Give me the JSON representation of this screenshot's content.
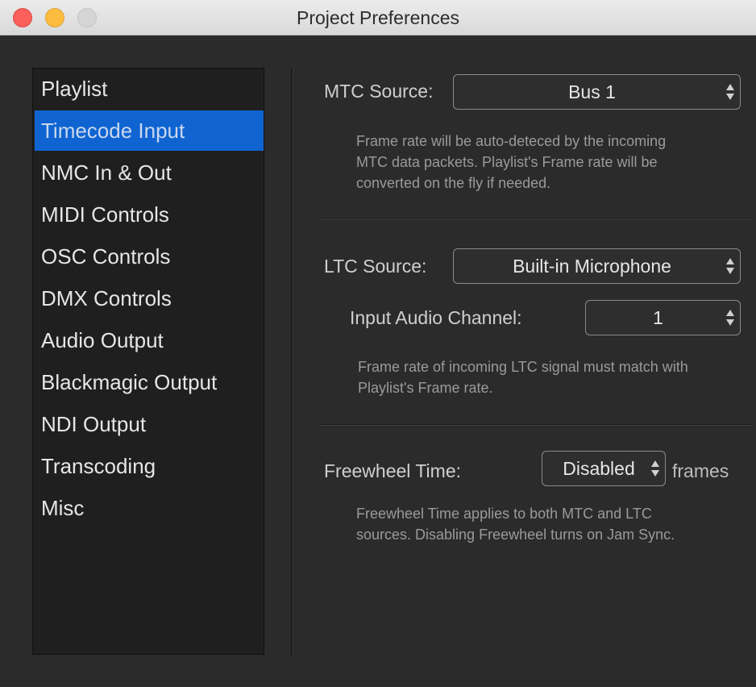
{
  "window": {
    "title": "Project Preferences"
  },
  "sidebar": {
    "items": [
      {
        "label": "Playlist"
      },
      {
        "label": "Timecode Input"
      },
      {
        "label": "NMC In & Out"
      },
      {
        "label": "MIDI Controls"
      },
      {
        "label": "OSC Controls"
      },
      {
        "label": "DMX Controls"
      },
      {
        "label": "Audio Output"
      },
      {
        "label": "Blackmagic Output"
      },
      {
        "label": "NDI Output"
      },
      {
        "label": "Transcoding"
      },
      {
        "label": "Misc"
      }
    ],
    "selected": "Timecode Input"
  },
  "mtc": {
    "label": "MTC Source:",
    "value": "Bus 1",
    "desc_line1": "Frame rate will be auto-deteced by the incoming",
    "desc_line2": "MTC data packets. Playlist's Frame rate will be",
    "desc_line3": "converted on the fly if needed."
  },
  "ltc": {
    "label": "LTC Source:",
    "value": "Built-in Microphone",
    "channel_label": "Input Audio Channel:",
    "channel_value": "1",
    "desc_line1": "Frame rate of incoming LTC signal must match with",
    "desc_line2": "Playlist's Frame rate."
  },
  "freewheel": {
    "label": "Freewheel Time:",
    "value": "Disabled",
    "unit": "frames",
    "desc_line1": "Freewheel Time applies to both MTC and LTC",
    "desc_line2": "sources. Disabling Freewheel turns on Jam Sync."
  },
  "colors": {
    "accent": "#0f64d2",
    "background": "#2b2b2b",
    "sidebar": "#1f1f1f"
  }
}
